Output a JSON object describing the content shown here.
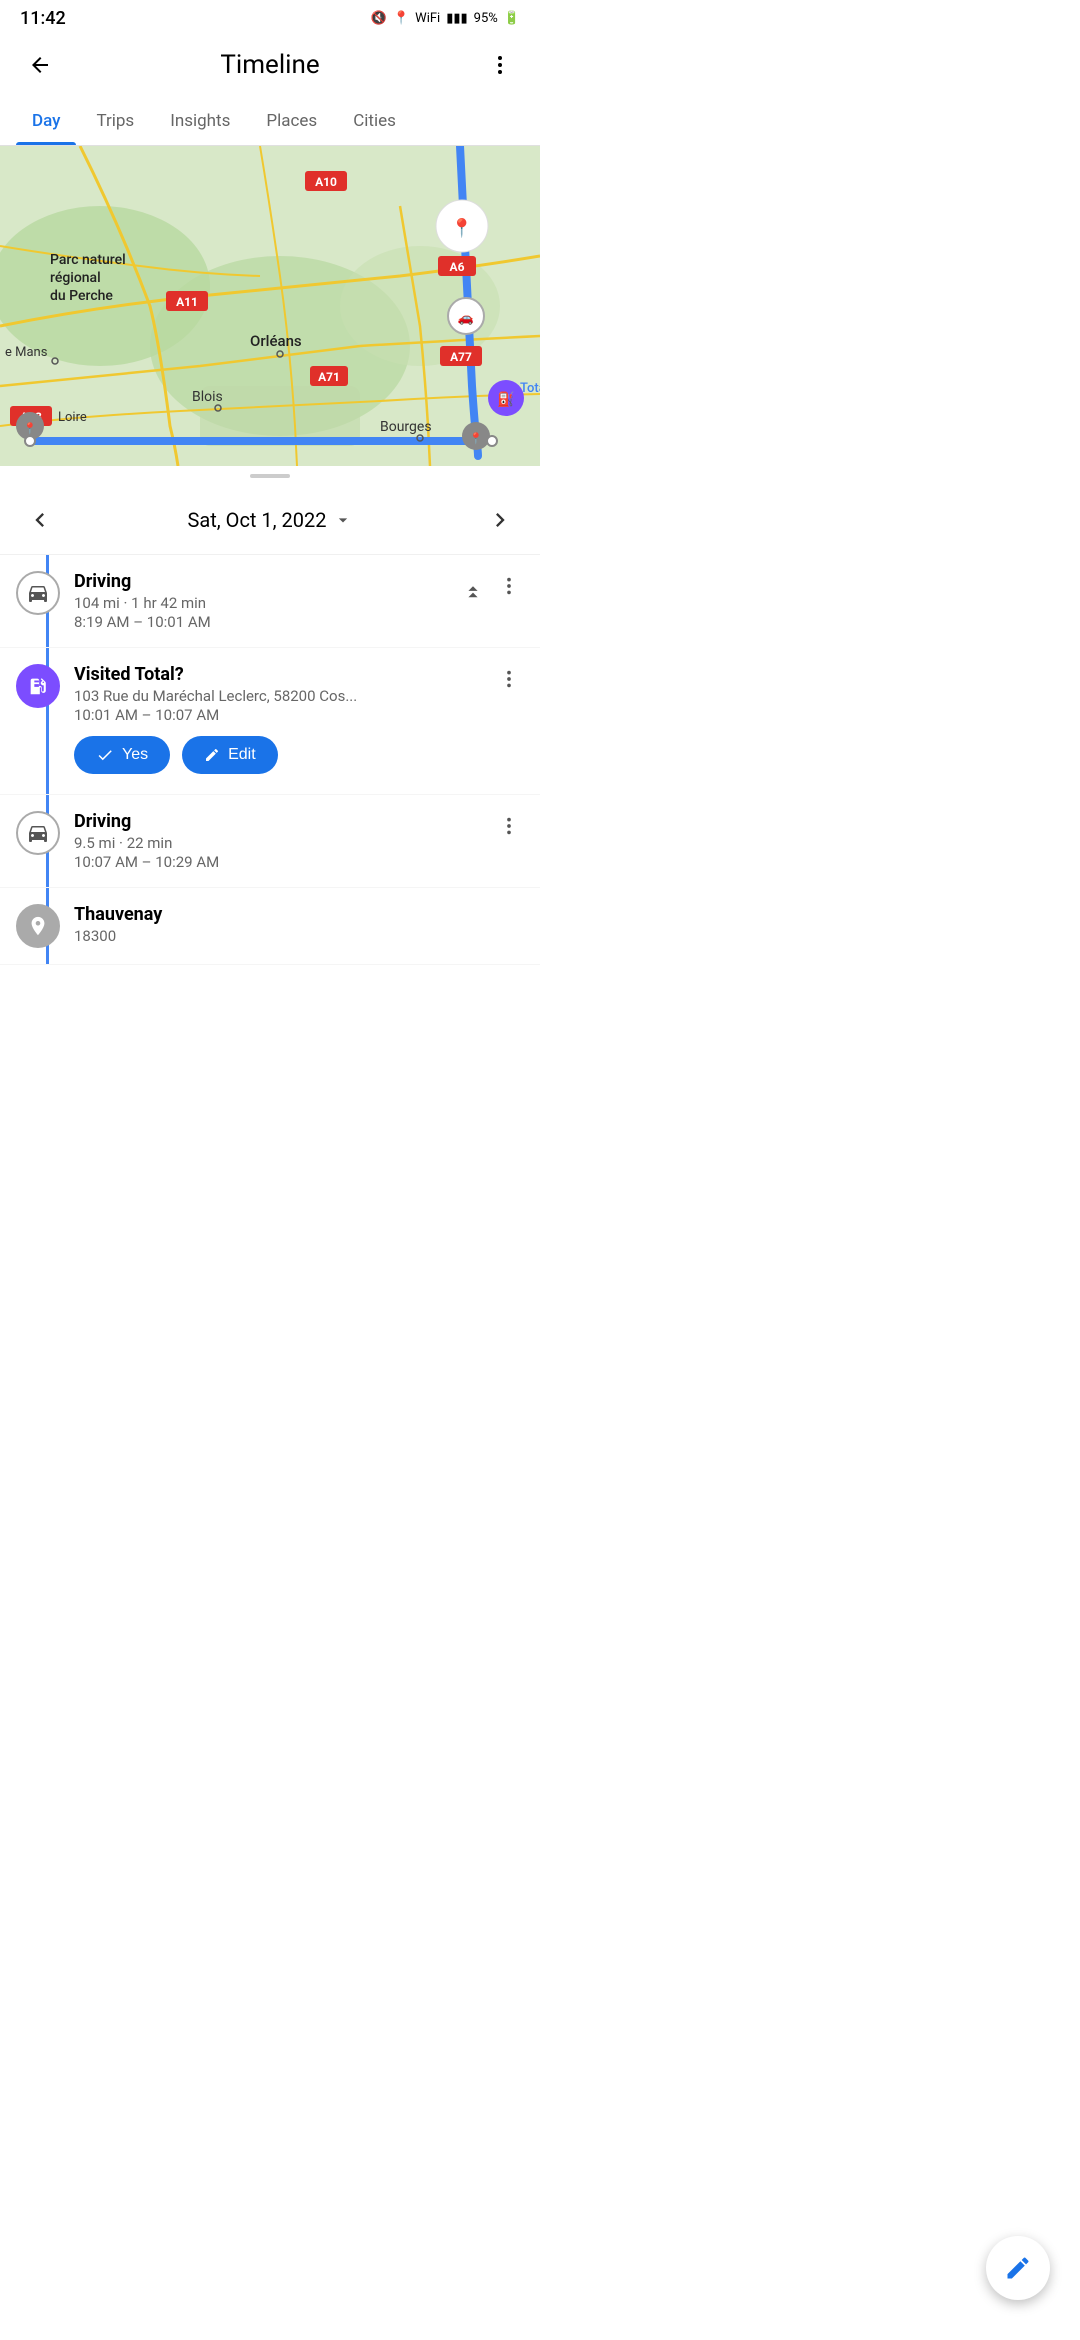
{
  "statusBar": {
    "time": "11:42",
    "battery": "95%"
  },
  "appBar": {
    "title": "Timeline",
    "backLabel": "back",
    "moreLabel": "more options"
  },
  "tabs": [
    {
      "label": "Day",
      "active": true
    },
    {
      "label": "Trips",
      "active": false
    },
    {
      "label": "Insights",
      "active": false
    },
    {
      "label": "Places",
      "active": false
    },
    {
      "label": "Cities",
      "active": false
    }
  ],
  "dateNav": {
    "date": "Sat, Oct 1, 2022",
    "prevLabel": "previous day",
    "nextLabel": "next day"
  },
  "timeline": [
    {
      "type": "driving",
      "title": "Driving",
      "sub": "104 mi · 1 hr 42 min",
      "time": "8:19 AM – 10:01 AM",
      "hasCollapse": true,
      "hasMore": true
    },
    {
      "type": "gas",
      "title": "Visited Total?",
      "sub": "103 Rue du Maréchal Leclerc, 58200 Cos...",
      "time": "10:01 AM – 10:07 AM",
      "hasYesEdit": true,
      "hasMore": true,
      "yesLabel": "Yes",
      "editLabel": "Edit"
    },
    {
      "type": "driving",
      "title": "Driving",
      "sub": "9.5 mi · 22 min",
      "time": "10:07 AM – 10:29 AM",
      "hasMore": true
    },
    {
      "type": "place",
      "title": "Thauvenay",
      "sub": "18300",
      "time": ""
    }
  ],
  "fab": {
    "label": "edit"
  },
  "mapCities": [
    "Orléans",
    "Blois",
    "Bourges",
    "e Mans",
    "Loire"
  ],
  "mapRoads": [
    "A28",
    "A10",
    "A11",
    "A6",
    "A77",
    "A71"
  ]
}
